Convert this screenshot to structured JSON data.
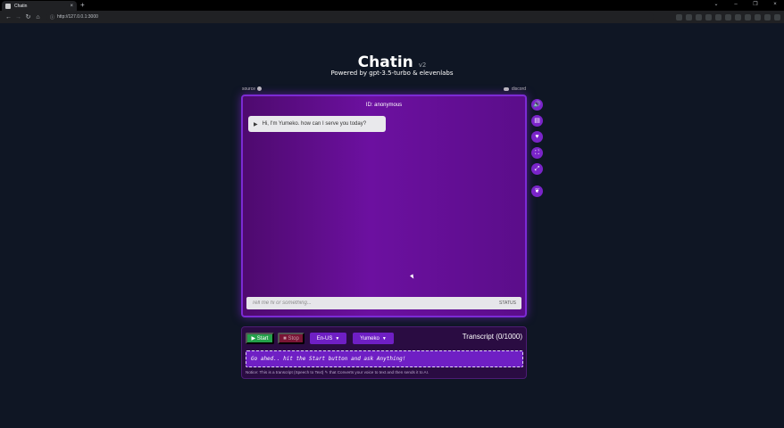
{
  "browser": {
    "tab_title": "Chatin",
    "tab_close": "×",
    "new_tab": "+",
    "url": "http://127.0.0.1:3000",
    "window_controls": [
      "⌄",
      "–",
      "❐",
      "×"
    ],
    "nav": {
      "back": "←",
      "forward": "→",
      "reload": "↻",
      "home": "⌂"
    }
  },
  "header": {
    "title": "Chatin",
    "version": "v2",
    "subtitle": "Powered by gpt-3.5-turbo & elevenlabs"
  },
  "links": {
    "source": "source",
    "discord": "discord"
  },
  "chat": {
    "id_label": "ID: anonymous",
    "messages": [
      {
        "text": "Hi, I'm Yumeko. how can I serve you today?"
      }
    ],
    "input_placeholder": "Tell me hi or something...",
    "status": "STATUS"
  },
  "side_buttons": [
    {
      "icon": "volume-icon",
      "glyph": "🔊"
    },
    {
      "icon": "document-icon",
      "glyph": "▤"
    },
    {
      "icon": "heart-icon",
      "glyph": "♥"
    },
    {
      "icon": "screenshot-icon",
      "glyph": "⛶"
    },
    {
      "icon": "fullscreen-icon",
      "glyph": "⤢"
    },
    {
      "icon": "leaf-icon",
      "glyph": "❦"
    }
  ],
  "controls": {
    "start_label": "▶ Start",
    "stop_label": "■ Stop",
    "language": "En-US",
    "voice": "Yumeko",
    "transcript_count": "Transcript (0/1000)",
    "transcript_text": "Go ahed.. hit the Start button and ask Anything!",
    "notice": "Notice: This is a transcript (Speech to Text) ✎ that Converts your voice to text and then sends it to AI."
  },
  "colors": {
    "background": "#0f1624",
    "accent_purple": "#7a24c9",
    "start_green": "#24a04a",
    "stop_red": "#7a1535"
  }
}
